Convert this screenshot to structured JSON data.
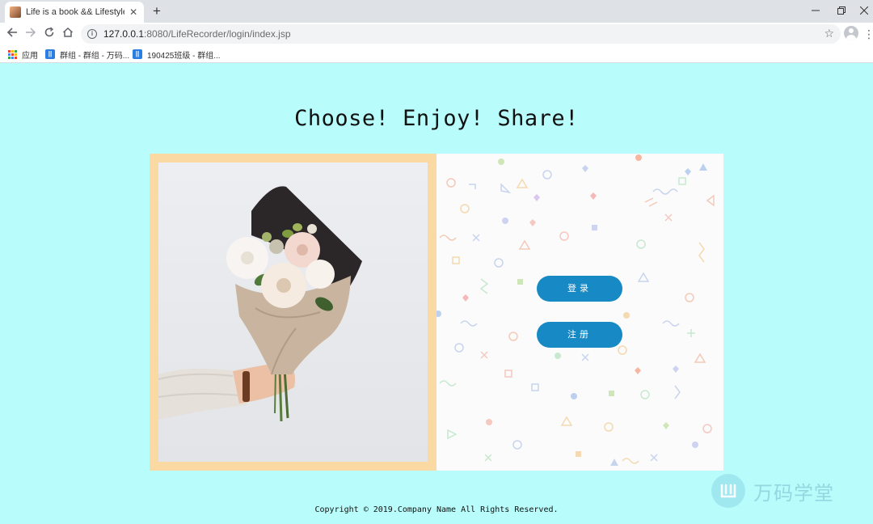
{
  "browser": {
    "tab_title": "Life is a book && Lifestyle is a",
    "url_host": "127.0.0.1",
    "url_rest": ":8080/LifeRecorder/login/index.jsp",
    "bookmarks": [
      {
        "label": "应用"
      },
      {
        "label": "群组 - 群组 - 万码..."
      },
      {
        "label": "190425班级 - 群组..."
      }
    ]
  },
  "page": {
    "headline": "Choose! Enjoy! Share!",
    "login_label": "登录",
    "register_label": "注册",
    "copyright": "Copyright © 2019.Company Name All Rights Reserved.",
    "watermark": "万码学堂"
  },
  "colors": {
    "page_bg": "#b8fdfb",
    "frame": "#fbd9a3",
    "button": "#1789c4"
  }
}
